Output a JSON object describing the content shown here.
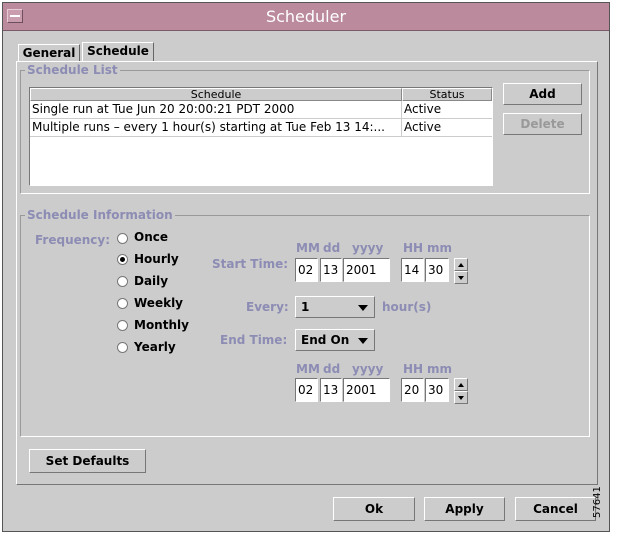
{
  "window": {
    "title": "Scheduler"
  },
  "tabs": [
    {
      "label": "General"
    },
    {
      "label": "Schedule"
    }
  ],
  "schedule_list": {
    "legend": "Schedule List",
    "columns": [
      "Schedule",
      "Status"
    ],
    "rows": [
      {
        "schedule": "Single run at Tue Jun 20 20:00:21 PDT 2000",
        "status": "Active"
      },
      {
        "schedule": "Multiple runs – every 1 hour(s) starting at Tue Feb 13 14:...",
        "status": "Active"
      }
    ],
    "add_label": "Add",
    "delete_label": "Delete"
  },
  "schedule_info": {
    "legend": "Schedule Information",
    "frequency_label": "Frequency:",
    "frequencies": [
      {
        "label": "Once",
        "selected": false
      },
      {
        "label": "Hourly",
        "selected": true
      },
      {
        "label": "Daily",
        "selected": false
      },
      {
        "label": "Weekly",
        "selected": false
      },
      {
        "label": "Monthly",
        "selected": false
      },
      {
        "label": "Yearly",
        "selected": false
      }
    ],
    "date_headers": {
      "mm": "MM",
      "dd": "dd",
      "yyyy": "yyyy",
      "hh": "HH",
      "min": "mm"
    },
    "start_time_label": "Start Time:",
    "start": {
      "month": "02",
      "day": "13",
      "year": "2001",
      "hour": "14",
      "minute": "30"
    },
    "every_label": "Every:",
    "every_value": "1",
    "every_unit": "hour(s)",
    "end_time_label": "End Time:",
    "end_mode": "End On",
    "end": {
      "month": "02",
      "day": "13",
      "year": "2001",
      "hour": "20",
      "minute": "30"
    }
  },
  "footer": {
    "set_defaults_label": "Set Defaults",
    "ok_label": "Ok",
    "apply_label": "Apply",
    "cancel_label": "Cancel"
  },
  "figure_id": "57641"
}
